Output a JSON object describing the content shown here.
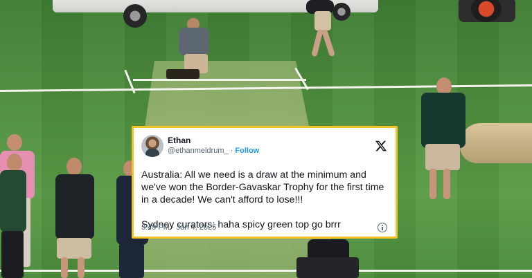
{
  "tweet": {
    "display_name": "Ethan",
    "handle": "@ethanmeldrum_",
    "separator": "·",
    "follow_label": "Follow",
    "text": "Australia: All we need is a draw at the minimum and we've won the Border-Gavaskar Trophy for the first time in a decade! We can't afford to lose!!!\n\nSydney curators: haha spicy green top go brrr",
    "timestamp": "3:49 PM · Jan 4, 2025",
    "platform_icon": "x-logo-icon",
    "info_icon": "info-icon"
  },
  "colors": {
    "card_border": "#f3c425",
    "follow_blue": "#1d9bf0",
    "grass": "#4f8f3e"
  }
}
